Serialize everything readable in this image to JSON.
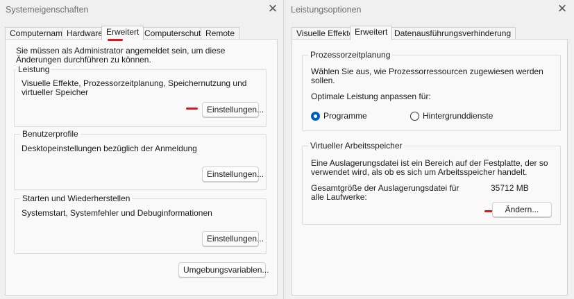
{
  "left": {
    "title": "Systemeigenschaften",
    "close_glyph": "✕",
    "tabs": [
      {
        "label": "Computername"
      },
      {
        "label": "Hardware"
      },
      {
        "label": "Erweitert",
        "active": true
      },
      {
        "label": "Computerschutz"
      },
      {
        "label": "Remote"
      }
    ],
    "admin_notice": "Sie müssen als Administrator angemeldet sein, um diese Änderungen durchführen zu können.",
    "performance": {
      "legend": "Leistung",
      "description": "Visuelle Effekte, Prozessorzeitplanung, Speichernutzung und virtueller Speicher",
      "button": "Einstellungen..."
    },
    "profiles": {
      "legend": "Benutzerprofile",
      "description": "Desktopeinstellungen bezüglich der Anmeldung",
      "button": "Einstellungen..."
    },
    "startup": {
      "legend": "Starten und Wiederherstellen",
      "description": "Systemstart, Systemfehler und Debuginformationen",
      "button": "Einstellungen..."
    },
    "env_button": "Umgebungsvariablen..."
  },
  "right": {
    "title": "Leistungsoptionen",
    "close_glyph": "✕",
    "tabs": [
      {
        "label": "Visuelle Effekte"
      },
      {
        "label": "Erweitert",
        "active": true
      },
      {
        "label": "Datenausführungsverhinderung"
      }
    ],
    "scheduling": {
      "legend": "Prozessorzeitplanung",
      "description": "Wählen Sie aus, wie Prozessorressourcen zugewiesen werden sollen.",
      "adjust_label": "Optimale Leistung anpassen für:",
      "options": [
        {
          "label": "Programme",
          "selected": true
        },
        {
          "label": "Hintergrunddienste",
          "selected": false
        }
      ]
    },
    "virtual_memory": {
      "legend": "Virtueller Arbeitsspeicher",
      "description": "Eine Auslagerungsdatei ist ein Bereich auf der Festplatte, der so verwendet wird, als ob es sich um Arbeitsspeicher handelt.",
      "total_label": "Gesamtgröße der Auslagerungsdatei für alle Laufwerke:",
      "total_value": "35712 MB",
      "button": "Ändern..."
    }
  },
  "colors": {
    "annotation_red": "#e0141d",
    "radio_accent": "#005fb8",
    "window_bg": "#f0f0f0",
    "panel_bg": "#f9f9f9"
  }
}
